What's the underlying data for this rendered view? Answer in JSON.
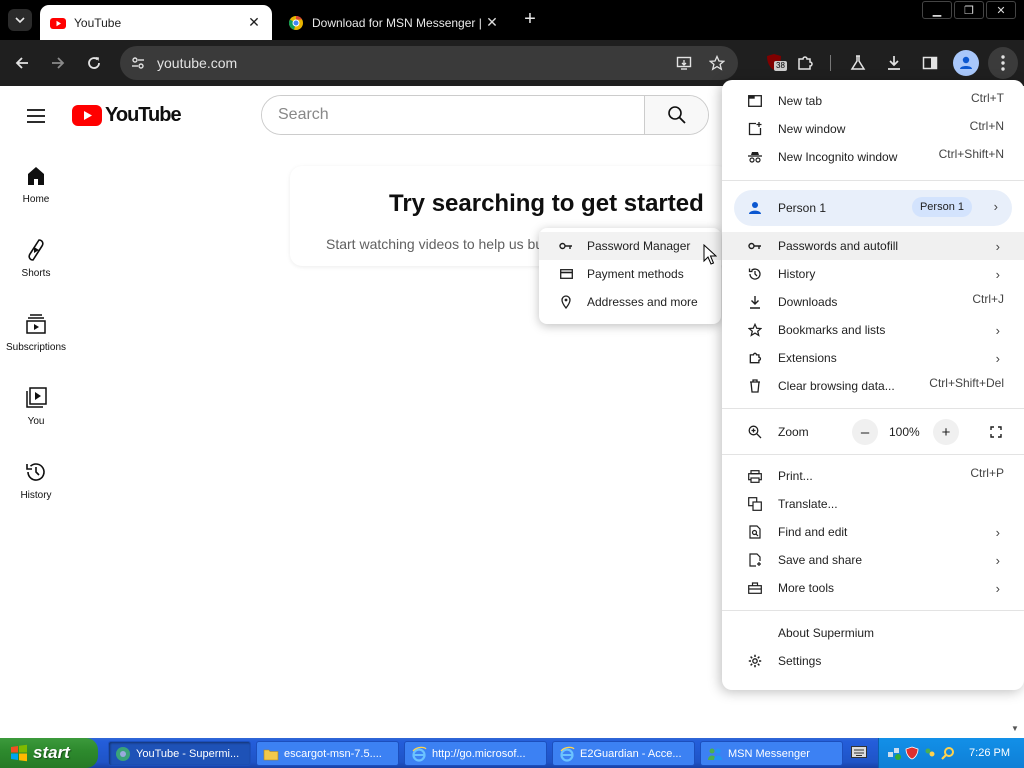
{
  "tabs": [
    {
      "title": "YouTube",
      "active": true
    },
    {
      "title": "Download for MSN Messenger | Es",
      "active": false
    }
  ],
  "toolbar": {
    "url": "youtube.com",
    "extension_badge": "38"
  },
  "youtube": {
    "logo_text": "YouTube",
    "search_placeholder": "Search",
    "guide": [
      {
        "label": "Home",
        "icon": "home-icon"
      },
      {
        "label": "Shorts",
        "icon": "shorts-icon"
      },
      {
        "label": "Subscriptions",
        "icon": "subscriptions-icon"
      },
      {
        "label": "You",
        "icon": "you-icon"
      },
      {
        "label": "History",
        "icon": "history-icon"
      }
    ],
    "card_title": "Try searching to get started",
    "card_subtitle": "Start watching videos to help us bu"
  },
  "submenu": {
    "items": [
      {
        "label": "Password Manager",
        "icon": "key-icon"
      },
      {
        "label": "Payment methods",
        "icon": "credit-card-icon"
      },
      {
        "label": "Addresses and more",
        "icon": "location-pin-icon"
      }
    ]
  },
  "menu": {
    "new_tab": {
      "label": "New tab",
      "shortcut": "Ctrl+T"
    },
    "new_window": {
      "label": "New window",
      "shortcut": "Ctrl+N"
    },
    "new_incognito": {
      "label": "New Incognito window",
      "shortcut": "Ctrl+Shift+N"
    },
    "profile": {
      "label": "Person 1",
      "chip": "Person 1"
    },
    "passwords": {
      "label": "Passwords and autofill"
    },
    "history": {
      "label": "History"
    },
    "downloads": {
      "label": "Downloads",
      "shortcut": "Ctrl+J"
    },
    "bookmarks": {
      "label": "Bookmarks and lists"
    },
    "extensions": {
      "label": "Extensions"
    },
    "clear_data": {
      "label": "Clear browsing data...",
      "shortcut": "Ctrl+Shift+Del"
    },
    "zoom": {
      "label": "Zoom",
      "value": "100%",
      "minus": "–",
      "plus": "+"
    },
    "print": {
      "label": "Print...",
      "shortcut": "Ctrl+P"
    },
    "translate": {
      "label": "Translate..."
    },
    "find_edit": {
      "label": "Find and edit"
    },
    "save_share": {
      "label": "Save and share"
    },
    "more_tools": {
      "label": "More tools"
    },
    "about": {
      "label": "About Supermium"
    },
    "settings": {
      "label": "Settings"
    }
  },
  "taskbar": {
    "start_label": "start",
    "items": [
      {
        "label": "YouTube - Supermi...",
        "active": true
      },
      {
        "label": "escargot-msn-7.5....",
        "active": false
      },
      {
        "label": "http://go.microsof...",
        "active": false
      },
      {
        "label": "E2Guardian - Acce...",
        "active": false
      },
      {
        "label": "MSN Messenger",
        "active": false
      }
    ],
    "clock": "7:26 PM"
  },
  "colors": {
    "youtube_red": "#ff0000",
    "menu_hover": "#f0f0f0",
    "profile_bg": "#e8effa",
    "taskbar_blue": "#245edb",
    "start_green": "#2e8b2e"
  }
}
